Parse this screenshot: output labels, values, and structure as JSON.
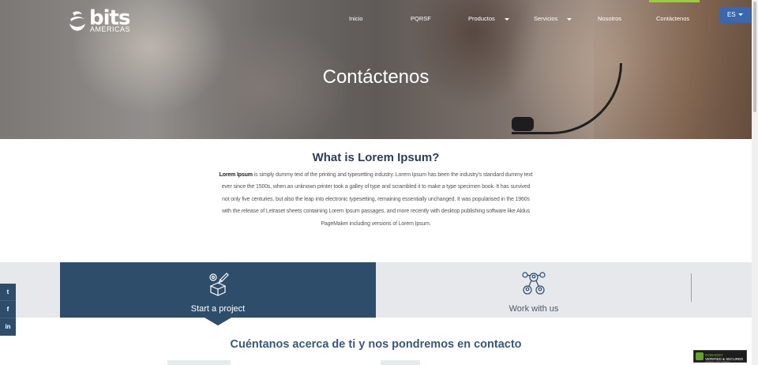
{
  "header": {
    "logo": {
      "word": "bits",
      "sub": "AMERICAS"
    },
    "nav": [
      {
        "label": "Inicio",
        "dropdown": false
      },
      {
        "label": "PQRSF",
        "dropdown": false
      },
      {
        "label": "Productos",
        "dropdown": true
      },
      {
        "label": "Servicios",
        "dropdown": true
      },
      {
        "label": "Nosotros",
        "dropdown": false
      },
      {
        "label": "Contáctenos",
        "dropdown": false,
        "active": true
      }
    ],
    "language": "ES",
    "colors": {
      "accent": "#9fcb3b",
      "language_button": "#3a67b1"
    }
  },
  "hero": {
    "title": "Contáctenos"
  },
  "intro": {
    "title": "What is Lorem Ipsum?",
    "bold_lead": "Lorem Ipsum",
    "body": " is simply dummy text of the printing and typesetting industry. Lorem Ipsum has been the industry's standard dummy text ever since the 1500s, when an unknown printer took a galley of type and scrambled it to make a type specimen book. It has survived not only five centuries, but also the leap into electronic typesetting, remaining essentially unchanged. It was popularised in the 1960s with the release of Letraset sheets containing Lorem Ipsum passages, and more recently with desktop publishing software like Aldus PageMaker including versions of Lorem Ipsum."
  },
  "tabs": [
    {
      "label": "Start a project",
      "icon": "project-box-icon",
      "selected": true
    },
    {
      "label": "Work with us",
      "icon": "team-network-icon",
      "selected": false
    }
  ],
  "contact": {
    "heading": "Cuéntanos acerca de ti y nos pondremos en contacto"
  },
  "social": [
    {
      "icon": "twitter-icon",
      "glyph": "t"
    },
    {
      "icon": "facebook-icon",
      "glyph": "f"
    },
    {
      "icon": "linkedin-icon",
      "glyph": "in"
    }
  ],
  "seal": {
    "line1": "GODADDY",
    "line2": "VERIFIED & SECURED",
    "line3": "VERIFY SECURITY"
  },
  "colors": {
    "primary": "#2e4d6b",
    "tab_inactive": "#e6e8eb",
    "heading": "#2d3e56"
  }
}
